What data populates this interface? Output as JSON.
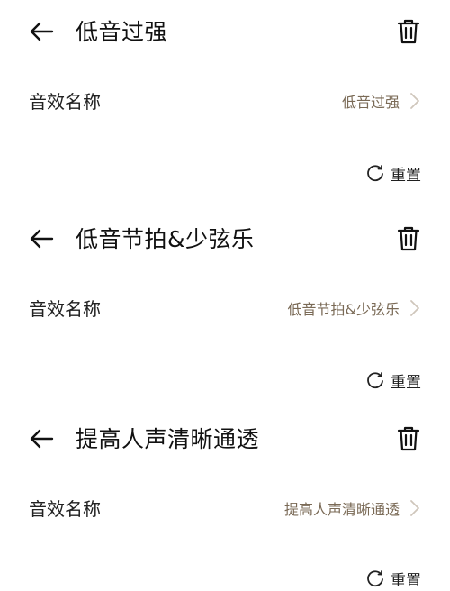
{
  "icons": {
    "back": "arrow-left-icon",
    "delete": "trash-icon",
    "chevron": "chevron-right-icon",
    "reset": "refresh-icon"
  },
  "colors": {
    "value_text": "#7a6a56",
    "chevron": "#cfc6bb"
  },
  "presets": [
    {
      "title": "低音过强",
      "field_label": "音效名称",
      "field_value": "低音过强",
      "reset_label": "重置"
    },
    {
      "title": "低音节拍&少弦乐",
      "field_label": "音效名称",
      "field_value": "低音节拍&少弦乐",
      "reset_label": "重置"
    },
    {
      "title": "提高人声清晰通透",
      "field_label": "音效名称",
      "field_value": "提高人声清晰通透",
      "reset_label": "重置"
    }
  ]
}
